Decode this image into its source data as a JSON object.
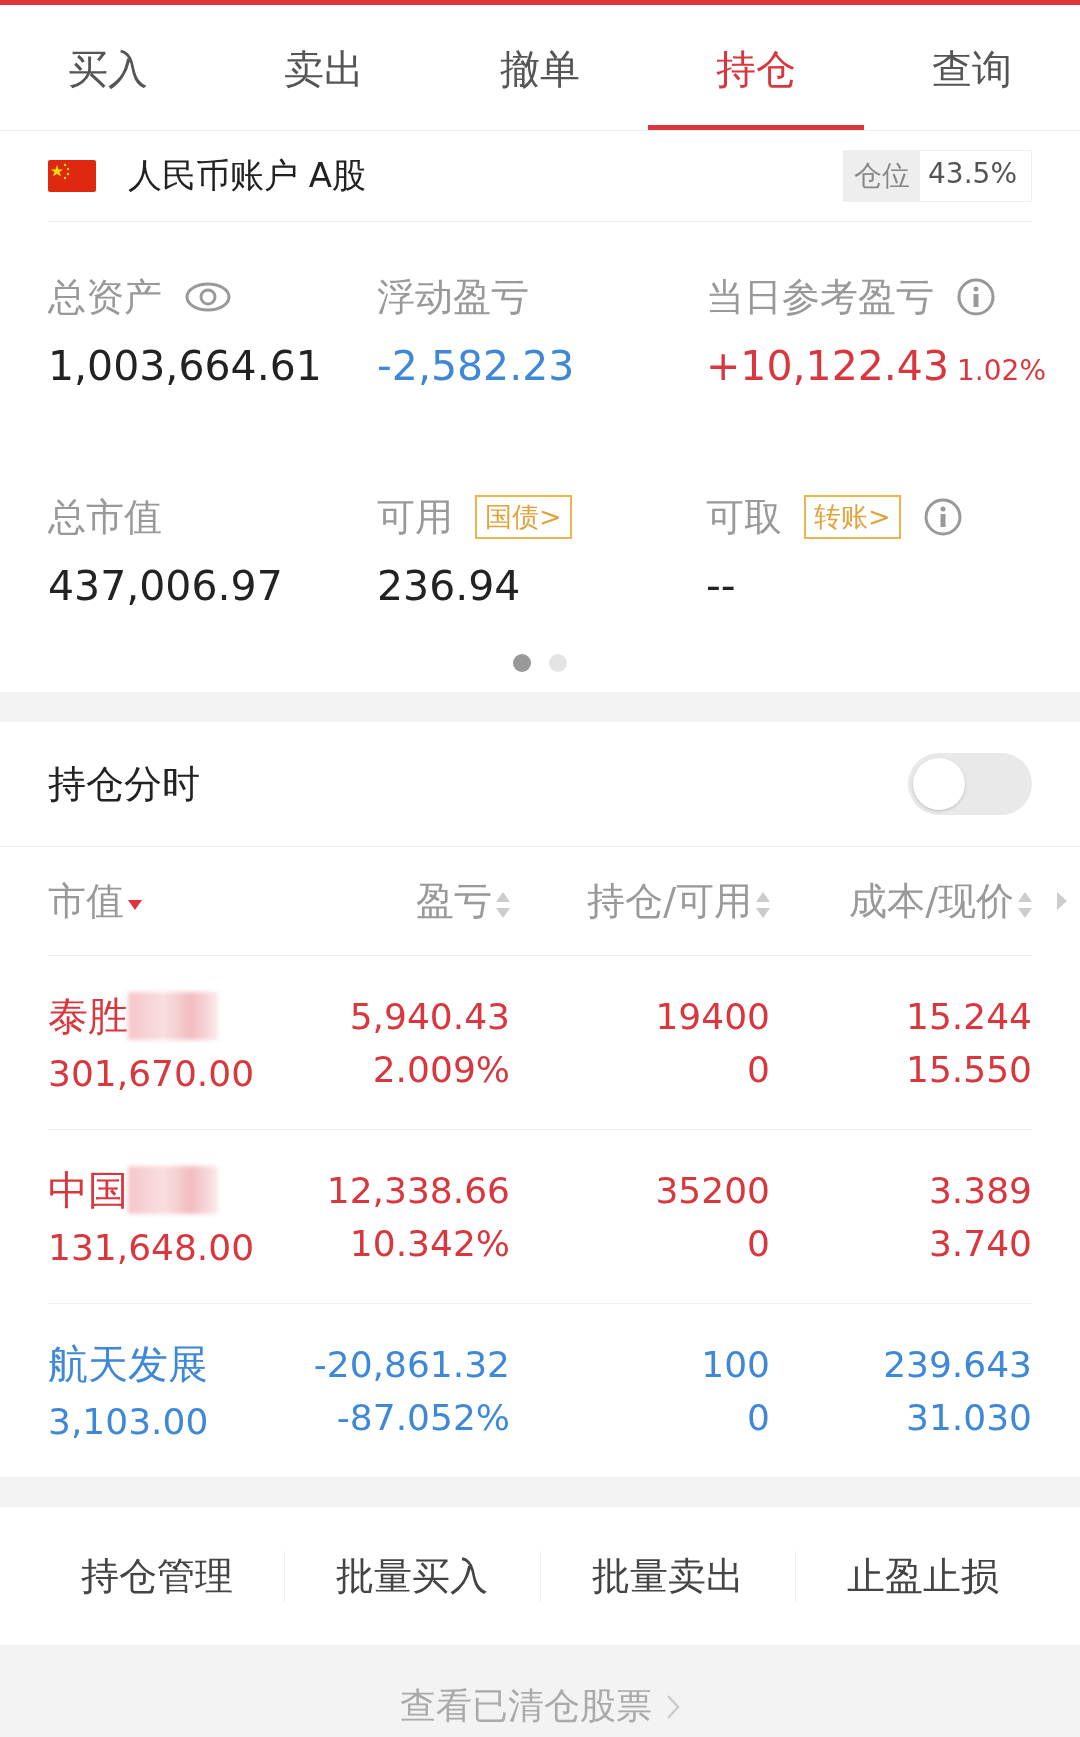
{
  "tabs": [
    {
      "label": "买入",
      "selected": false
    },
    {
      "label": "卖出",
      "selected": false
    },
    {
      "label": "撤单",
      "selected": false
    },
    {
      "label": "持仓",
      "selected": true
    },
    {
      "label": "查询",
      "selected": false
    }
  ],
  "account": {
    "name": "人民币账户 A股",
    "position_label": "仓位",
    "position_value": "43.5%"
  },
  "stats": [
    {
      "kind": "hideable",
      "label": "总资产",
      "value": "1,003,664.61",
      "color": "#222222"
    },
    {
      "kind": "plain",
      "label": "浮动盈亏",
      "value": "-2,582.23",
      "color": "#3f88d8"
    },
    {
      "kind": "explained",
      "label": "当日参考盈亏",
      "value": "+10,122.43",
      "extra": "1.02%",
      "color": "#d9363e"
    },
    {
      "kind": "plain",
      "label": "总市值",
      "value": "437,006.97",
      "color": "#222222"
    },
    {
      "kind": "plain",
      "label": "可用",
      "tag": "国债>",
      "value": "236.94",
      "color": "#222222"
    },
    {
      "kind": "explained",
      "label": "可取",
      "tag": "转账>",
      "value": "--",
      "color": "#222222"
    }
  ],
  "pager": [
    {
      "selected": true
    },
    {
      "selected": false
    }
  ],
  "intraday": {
    "label": "持仓分时",
    "on": false
  },
  "columns": [
    {
      "label": "市值",
      "sorted": true
    },
    {
      "label": "盈亏",
      "sorted": false
    },
    {
      "label": "持仓/可用",
      "sorted": false
    },
    {
      "label": "成本/现价",
      "sorted": false
    }
  ],
  "rows": [
    {
      "name": "泰胜",
      "blurred": true,
      "color": "#d9363e",
      "market_value": "301,670.00",
      "pnl": "5,940.43",
      "pnl_pct": "2.009%",
      "holding": "19400",
      "available": "0",
      "cost": "15.244",
      "price": "15.550"
    },
    {
      "name": "中国",
      "blurred": true,
      "color": "#d9363e",
      "market_value": "131,648.00",
      "pnl": "12,338.66",
      "pnl_pct": "10.342%",
      "holding": "35200",
      "available": "0",
      "cost": "3.389",
      "price": "3.740"
    },
    {
      "name": "航天发展",
      "blurred": false,
      "color": "#3f88d8",
      "market_value": "3,103.00",
      "pnl": "-20,861.32",
      "pnl_pct": "-87.052%",
      "holding": "100",
      "available": "0",
      "cost": "239.643",
      "price": "31.030"
    }
  ],
  "actions": [
    "持仓管理",
    "批量买入",
    "批量卖出",
    "止盈止损"
  ],
  "cleared_link": "查看已清仓股票"
}
